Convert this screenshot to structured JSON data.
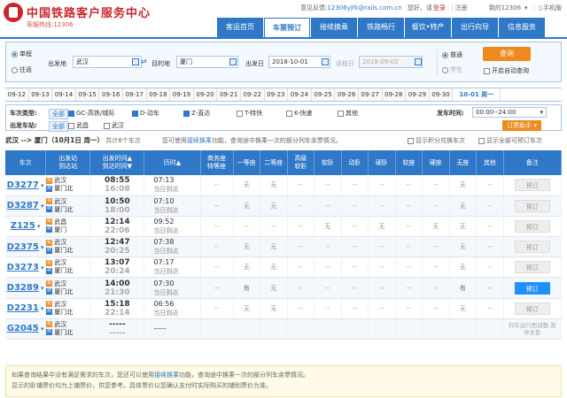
{
  "header": {
    "title": "中国铁路客户服务中心",
    "hotline": "客服热线:12306",
    "feedback": "意见反馈:",
    "feedback_email": "12306yjfk@rails.com.cn",
    "greeting": "您好，请",
    "login": "登录",
    "register": "注册",
    "my12306": "我的12306",
    "mobile": "手机版"
  },
  "nav": [
    {
      "label": "客运首页",
      "active": false
    },
    {
      "label": "车票预订",
      "active": true
    },
    {
      "label": "接续换乘",
      "active": false
    },
    {
      "label": "铁路畅行",
      "active": false
    },
    {
      "label": "餐饮•特产",
      "active": false
    },
    {
      "label": "出行向导",
      "active": false
    },
    {
      "label": "信息服务",
      "active": false
    }
  ],
  "search": {
    "one_way": "单程",
    "round_trip": "往返",
    "from_label": "出发地",
    "from_value": "武汉",
    "to_label": "目的地",
    "to_value": "厦门",
    "date_label": "出发日",
    "date_value": "2018-10-01",
    "return_label": "返程日",
    "return_value": "2018-09-02",
    "normal": "普通",
    "student": "学生",
    "query": "查询",
    "auto_query": "开启自动查询"
  },
  "dates": [
    "09-12",
    "09-13",
    "09-14",
    "09-15",
    "09-16",
    "09-17",
    "09-18",
    "09-19",
    "09-20",
    "09-21",
    "09-22",
    "09-23",
    "09-24",
    "09-25",
    "09-26",
    "09-27",
    "09-28",
    "09-29",
    "09-30",
    "10-01 周一"
  ],
  "filters": {
    "type_label": "车次类型:",
    "all": "全部",
    "types": [
      {
        "label": "GC-高铁/城际",
        "on": true
      },
      {
        "label": "D-动车",
        "on": true
      },
      {
        "label": "Z-直达",
        "on": true
      },
      {
        "label": "T-特快",
        "on": false
      },
      {
        "label": "K-快速",
        "on": false
      },
      {
        "label": "其他",
        "on": false
      }
    ],
    "depart_time_label": "发车时间:",
    "depart_time_value": "00:00--24:00",
    "station_label": "出发车站:",
    "stations": [
      "武昌",
      "武汉"
    ],
    "booking_help": "订票助手"
  },
  "summary": {
    "route": "武汉 --> 厦门（10月1日 周一）",
    "count": "共计8个车次",
    "hint_pre": "您可使用",
    "hint_link": "接续换乘",
    "hint_post": "功能，查询途中换乘一次的部分列车余票情况。",
    "opt1": "显示积分兑换车次",
    "opt2": "显示全部可预订车次"
  },
  "table": {
    "headers": [
      "车次",
      "出发站\n到达站",
      "出发时间▲\n到达时间▼",
      "历时▲",
      "商务座\n特等座",
      "一等座",
      "二等座",
      "高级\n软卧",
      "软卧",
      "动卧",
      "硬卧",
      "软座",
      "硬座",
      "无座",
      "其他",
      "备注"
    ],
    "rows": [
      {
        "train": "D3277",
        "from": "武汉",
        "to": "厦门北",
        "dep": "08:55",
        "arr": "16:08",
        "dur": "07:13",
        "day": "当日到达",
        "seats": [
          "--",
          "无",
          "无",
          "--",
          "--",
          "--",
          "--",
          "--",
          "--",
          "无",
          "--"
        ],
        "remark": "预订",
        "bookable": false
      },
      {
        "train": "D3287",
        "from": "武汉",
        "to": "厦门北",
        "dep": "10:50",
        "arr": "18:00",
        "dur": "07:10",
        "day": "当日到达",
        "seats": [
          "--",
          "无",
          "无",
          "--",
          "--",
          "--",
          "--",
          "--",
          "--",
          "无",
          "--"
        ],
        "remark": "预订",
        "bookable": false
      },
      {
        "train": "Z125",
        "from": "武昌",
        "to": "厦门",
        "dep": "12:14",
        "arr": "22:06",
        "dur": "09:52",
        "day": "当日到达",
        "seats": [
          "--",
          "--",
          "--",
          "--",
          "无",
          "--",
          "无",
          "--",
          "无",
          "无",
          "--"
        ],
        "remark": "预订",
        "bookable": false
      },
      {
        "train": "D2375",
        "from": "武汉",
        "to": "厦门北",
        "dep": "12:47",
        "arr": "20:25",
        "dur": "07:38",
        "day": "当日到达",
        "seats": [
          "--",
          "无",
          "无",
          "--",
          "--",
          "--",
          "--",
          "--",
          "--",
          "无",
          "--"
        ],
        "remark": "预订",
        "bookable": false
      },
      {
        "train": "D3273",
        "from": "武汉",
        "to": "厦门北",
        "dep": "13:07",
        "arr": "20:24",
        "dur": "07:17",
        "day": "当日到达",
        "seats": [
          "--",
          "无",
          "无",
          "--",
          "--",
          "--",
          "--",
          "--",
          "--",
          "无",
          "--"
        ],
        "remark": "预订",
        "bookable": false
      },
      {
        "train": "D3289",
        "from": "武汉",
        "to": "厦门北",
        "dep": "14:00",
        "arr": "21:30",
        "dur": "07:30",
        "day": "当日到达",
        "seats": [
          "--",
          "有",
          "无",
          "--",
          "--",
          "--",
          "--",
          "--",
          "--",
          "有",
          "--"
        ],
        "remark": "预订",
        "bookable": true
      },
      {
        "train": "D2231",
        "from": "武汉",
        "to": "厦门北",
        "dep": "15:18",
        "arr": "22:14",
        "dur": "06:56",
        "day": "当日到达",
        "seats": [
          "--",
          "无",
          "无",
          "--",
          "--",
          "--",
          "--",
          "--",
          "--",
          "无",
          "--"
        ],
        "remark": "预订",
        "bookable": false
      },
      {
        "train": "G2045",
        "from": "武汉",
        "to": "厦门北",
        "dep": "-----",
        "arr": "-----",
        "dur": "-----",
        "day": "",
        "seats": [
          "",
          "",
          "",
          "",
          "",
          "",
          "",
          "",
          "",
          "",
          ""
        ],
        "remark": "列车运行图调整,暂停发售",
        "bookable": false
      }
    ]
  },
  "note": {
    "line1_pre": "如果查询结果中没有满足需求的车次，您还可以使用",
    "line1_link": "接续换乘",
    "line1_post": "功能，查询途中换乘一次的部分列车余票情况。",
    "line2": "显示的卧铺票价均为上铺票价，供您参考。具体票价以您确认支付时实际购买的铺别票价为准。"
  },
  "colors": {
    "primary": "#2f78c7",
    "accent": "#f08a1c",
    "brand": "#c9262a"
  }
}
